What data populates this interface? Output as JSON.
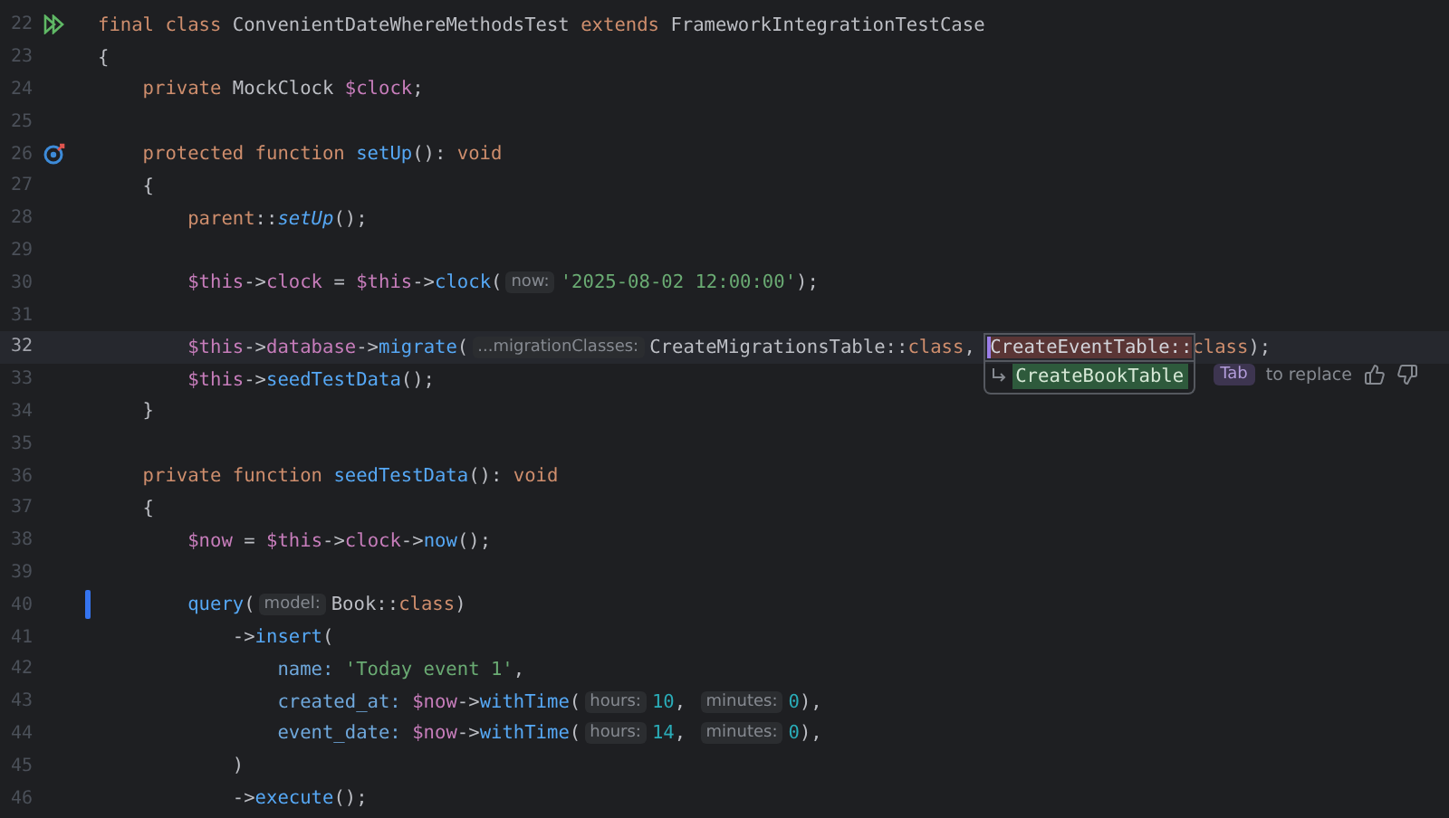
{
  "editor": {
    "lines": [
      {
        "number": "22",
        "current": false,
        "kind": "run",
        "segments": [
          {
            "kind": "code",
            "tokens": [
              {
                "text": "final class ",
                "kind": "keyword"
              },
              {
                "text": "ConvenientDateWhereMethodsTest ",
                "kind": "name"
              },
              {
                "text": "extends ",
                "kind": "keyword"
              },
              {
                "text": "FrameworkIntegrationTestCase",
                "kind": "name"
              }
            ]
          }
        ]
      },
      {
        "number": "23",
        "current": false,
        "kind": "plain",
        "segments": [
          {
            "kind": "code",
            "tokens": [
              {
                "text": "{",
                "kind": "name"
              }
            ]
          }
        ],
        "children": [
          {
            "number": "24",
            "current": false,
            "kind": "plain",
            "segments": [
              {
                "kind": "code",
                "tokens": [
                  {
                    "text": "private ",
                    "kind": "keyword"
                  },
                  {
                    "text": "MockClock ",
                    "kind": "name"
                  },
                  {
                    "text": "$clock",
                    "kind": "variable"
                  },
                  {
                    "text": ";",
                    "kind": "name"
                  }
                ]
              }
            ]
          },
          {
            "number": "25",
            "current": false,
            "kind": "plain"
          },
          {
            "number": "26",
            "current": false,
            "kind": "override",
            "segments": [
              {
                "kind": "code",
                "tokens": [
                  {
                    "text": "protected function ",
                    "kind": "keyword"
                  },
                  {
                    "text": "setUp",
                    "kind": "method"
                  },
                  {
                    "text": "(): ",
                    "kind": "name"
                  },
                  {
                    "text": "void",
                    "kind": "keyword"
                  }
                ]
              }
            ]
          },
          {
            "number": "27",
            "current": false,
            "kind": "plain",
            "segments": [
              {
                "kind": "code",
                "tokens": [
                  {
                    "text": "{",
                    "kind": "name"
                  }
                ]
              }
            ],
            "children": [
              {
                "number": "28",
                "current": false,
                "kind": "plain",
                "segments": [
                  {
                    "kind": "code",
                    "tokens": [
                      {
                        "text": "parent",
                        "kind": "keyword"
                      },
                      {
                        "text": "::",
                        "kind": "name"
                      },
                      {
                        "text": "setUp",
                        "kind": "static-call"
                      },
                      {
                        "text": "();",
                        "kind": "name"
                      }
                    ]
                  }
                ]
              },
              {
                "number": "29",
                "current": false,
                "kind": "plain"
              },
              {
                "number": "30",
                "current": false,
                "kind": "plain",
                "segments": [
                  {
                    "kind": "code",
                    "tokens": [
                      {
                        "text": "$this",
                        "kind": "variable"
                      },
                      {
                        "text": "->",
                        "kind": "name"
                      },
                      {
                        "text": "clock",
                        "kind": "variable"
                      },
                      {
                        "text": " = ",
                        "kind": "name"
                      },
                      {
                        "text": "$this",
                        "kind": "variable"
                      },
                      {
                        "text": "->",
                        "kind": "name"
                      },
                      {
                        "text": "clock",
                        "kind": "method"
                      },
                      {
                        "text": "(",
                        "kind": "name"
                      }
                    ]
                  },
                  {
                    "kind": "hint",
                    "text": "now:"
                  },
                  {
                    "kind": "code",
                    "tokens": [
                      {
                        "text": "'2025-08-02 12:00:00'",
                        "kind": "string"
                      },
                      {
                        "text": ");",
                        "kind": "name"
                      }
                    ]
                  }
                ]
              },
              {
                "number": "31",
                "current": false,
                "kind": "plain"
              },
              {
                "number": "32",
                "current": true,
                "kind": "plain",
                "segments": [
                  {
                    "kind": "code",
                    "tokens": [
                      {
                        "text": "$this",
                        "kind": "variable"
                      },
                      {
                        "text": "->",
                        "kind": "name"
                      },
                      {
                        "text": "database",
                        "kind": "variable"
                      },
                      {
                        "text": "->",
                        "kind": "name"
                      },
                      {
                        "text": "migrate",
                        "kind": "method"
                      },
                      {
                        "text": "(",
                        "kind": "name"
                      }
                    ]
                  },
                  {
                    "kind": "hint",
                    "text": "...migrationClasses:"
                  },
                  {
                    "kind": "code",
                    "tokens": [
                      {
                        "text": "CreateMigrationsTable::",
                        "kind": "name"
                      },
                      {
                        "text": "class",
                        "kind": "keyword"
                      },
                      {
                        "text": ", ",
                        "kind": "name"
                      }
                    ]
                  },
                  {
                    "kind": "suggestion",
                    "cursor": true,
                    "replaced": "CreateEventTable::",
                    "replacement": "CreateBookTable",
                    "key": "Tab",
                    "action": "to replace"
                  },
                  {
                    "kind": "code",
                    "tokens": [
                      {
                        "text": "class",
                        "kind": "keyword"
                      },
                      {
                        "text": ");",
                        "kind": "name"
                      }
                    ]
                  }
                ]
              },
              {
                "number": "33",
                "current": false,
                "kind": "plain",
                "segments": [
                  {
                    "kind": "code",
                    "tokens": [
                      {
                        "text": "$this",
                        "kind": "variable"
                      },
                      {
                        "text": "->",
                        "kind": "name"
                      },
                      {
                        "text": "seedTestData",
                        "kind": "method"
                      },
                      {
                        "text": "();",
                        "kind": "name"
                      }
                    ]
                  }
                ]
              }
            ]
          },
          {
            "number": "34",
            "current": false,
            "kind": "plain",
            "segments": [
              {
                "kind": "code",
                "tokens": [
                  {
                    "text": "}",
                    "kind": "name"
                  }
                ]
              }
            ]
          },
          {
            "number": "35",
            "current": false,
            "kind": "plain"
          },
          {
            "number": "36",
            "current": false,
            "kind": "plain",
            "segments": [
              {
                "kind": "code",
                "tokens": [
                  {
                    "text": "private function ",
                    "kind": "keyword"
                  },
                  {
                    "text": "seedTestData",
                    "kind": "method"
                  },
                  {
                    "text": "(): ",
                    "kind": "name"
                  },
                  {
                    "text": "void",
                    "kind": "keyword"
                  }
                ]
              }
            ]
          },
          {
            "number": "37",
            "current": false,
            "kind": "plain",
            "segments": [
              {
                "kind": "code",
                "tokens": [
                  {
                    "text": "{",
                    "kind": "name"
                  }
                ]
              }
            ],
            "children": [
              {
                "number": "38",
                "current": false,
                "kind": "plain",
                "segments": [
                  {
                    "kind": "code",
                    "tokens": [
                      {
                        "text": "$now",
                        "kind": "variable"
                      },
                      {
                        "text": " = ",
                        "kind": "name"
                      },
                      {
                        "text": "$this",
                        "kind": "variable"
                      },
                      {
                        "text": "->",
                        "kind": "name"
                      },
                      {
                        "text": "clock",
                        "kind": "variable"
                      },
                      {
                        "text": "->",
                        "kind": "name"
                      },
                      {
                        "text": "now",
                        "kind": "method"
                      },
                      {
                        "text": "();",
                        "kind": "name"
                      }
                    ]
                  }
                ]
              },
              {
                "number": "39",
                "current": false,
                "kind": "plain"
              },
              {
                "number": "40",
                "current": false,
                "kind": "changed",
                "segments": [
                  {
                    "kind": "code",
                    "tokens": [
                      {
                        "text": "query",
                        "kind": "method"
                      },
                      {
                        "text": "(",
                        "kind": "name"
                      }
                    ]
                  },
                  {
                    "kind": "hint",
                    "text": "model:"
                  },
                  {
                    "kind": "code",
                    "tokens": [
                      {
                        "text": "Book::",
                        "kind": "name"
                      },
                      {
                        "text": "class",
                        "kind": "keyword"
                      },
                      {
                        "text": ")",
                        "kind": "name"
                      }
                    ]
                  }
                ],
                "children": [
                  {
                    "number": "41",
                    "current": false,
                    "kind": "plain",
                    "segments": [
                      {
                        "kind": "code",
                        "tokens": [
                          {
                            "text": "->",
                            "kind": "name"
                          },
                          {
                            "text": "insert",
                            "kind": "method"
                          },
                          {
                            "text": "(",
                            "kind": "name"
                          }
                        ]
                      }
                    ],
                    "children": [
                      {
                        "number": "42",
                        "current": false,
                        "kind": "plain",
                        "segments": [
                          {
                            "kind": "code",
                            "tokens": [
                              {
                                "text": "name: ",
                                "kind": "argument"
                              },
                              {
                                "text": "'Today event 1'",
                                "kind": "string"
                              },
                              {
                                "text": ",",
                                "kind": "name"
                              }
                            ]
                          }
                        ]
                      },
                      {
                        "number": "43",
                        "current": false,
                        "kind": "plain",
                        "segments": [
                          {
                            "kind": "code",
                            "tokens": [
                              {
                                "text": "created_at: ",
                                "kind": "argument"
                              },
                              {
                                "text": "$now",
                                "kind": "variable"
                              },
                              {
                                "text": "->",
                                "kind": "name"
                              },
                              {
                                "text": "withTime",
                                "kind": "method"
                              },
                              {
                                "text": "(",
                                "kind": "name"
                              }
                            ]
                          },
                          {
                            "kind": "hint",
                            "text": "hours:"
                          },
                          {
                            "kind": "code",
                            "tokens": [
                              {
                                "text": "10",
                                "kind": "number"
                              },
                              {
                                "text": ", ",
                                "kind": "name"
                              }
                            ]
                          },
                          {
                            "kind": "hint",
                            "text": "minutes:"
                          },
                          {
                            "kind": "code",
                            "tokens": [
                              {
                                "text": "0",
                                "kind": "number"
                              },
                              {
                                "text": "),",
                                "kind": "name"
                              }
                            ]
                          }
                        ]
                      },
                      {
                        "number": "44",
                        "current": false,
                        "kind": "plain",
                        "segments": [
                          {
                            "kind": "code",
                            "tokens": [
                              {
                                "text": "event_date: ",
                                "kind": "argument"
                              },
                              {
                                "text": "$now",
                                "kind": "variable"
                              },
                              {
                                "text": "->",
                                "kind": "name"
                              },
                              {
                                "text": "withTime",
                                "kind": "method"
                              },
                              {
                                "text": "(",
                                "kind": "name"
                              }
                            ]
                          },
                          {
                            "kind": "hint",
                            "text": "hours:"
                          },
                          {
                            "kind": "code",
                            "tokens": [
                              {
                                "text": "14",
                                "kind": "number"
                              },
                              {
                                "text": ", ",
                                "kind": "name"
                              }
                            ]
                          },
                          {
                            "kind": "hint",
                            "text": "minutes:"
                          },
                          {
                            "kind": "code",
                            "tokens": [
                              {
                                "text": "0",
                                "kind": "number"
                              },
                              {
                                "text": "),",
                                "kind": "name"
                              }
                            ]
                          }
                        ]
                      }
                    ]
                  },
                  {
                    "number": "45",
                    "current": false,
                    "kind": "plain",
                    "segments": [
                      {
                        "kind": "code",
                        "tokens": [
                          {
                            "text": ")",
                            "kind": "name"
                          }
                        ]
                      }
                    ]
                  },
                  {
                    "number": "46",
                    "current": false,
                    "kind": "plain",
                    "segments": [
                      {
                        "kind": "code",
                        "tokens": [
                          {
                            "text": "->",
                            "kind": "name"
                          },
                          {
                            "text": "execute",
                            "kind": "method"
                          },
                          {
                            "text": "();",
                            "kind": "name"
                          }
                        ]
                      }
                    ]
                  }
                ]
              }
            ]
          }
        ]
      }
    ]
  }
}
